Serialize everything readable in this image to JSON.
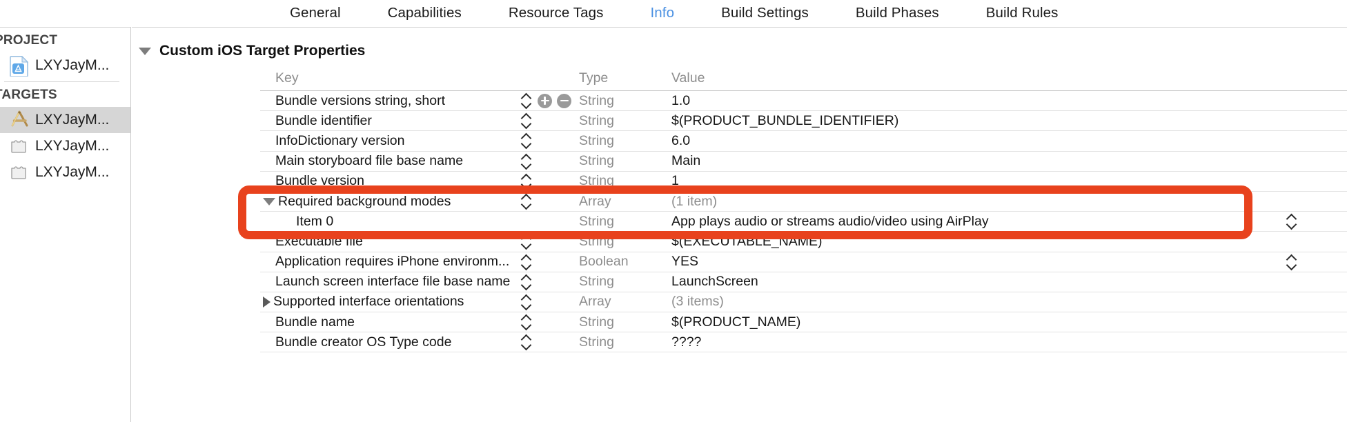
{
  "tabs": [
    {
      "label": "General",
      "active": false
    },
    {
      "label": "Capabilities",
      "active": false
    },
    {
      "label": "Resource Tags",
      "active": false
    },
    {
      "label": "Info",
      "active": true
    },
    {
      "label": "Build Settings",
      "active": false
    },
    {
      "label": "Build Phases",
      "active": false
    },
    {
      "label": "Build Rules",
      "active": false
    }
  ],
  "sidebar": {
    "project_header": "PROJECT",
    "targets_header": "TARGETS",
    "project_items": [
      {
        "label": "LXYJayM...",
        "icon": "project-document-icon"
      }
    ],
    "target_items": [
      {
        "label": "LXYJayM...",
        "icon": "app-target-icon",
        "selected": true
      },
      {
        "label": "LXYJayM...",
        "icon": "bundle-target-icon",
        "selected": false
      },
      {
        "label": "LXYJayM...",
        "icon": "bundle-target-icon",
        "selected": false
      }
    ]
  },
  "main": {
    "section_title": "Custom iOS Target Properties",
    "columns": {
      "key": "Key",
      "type": "Type",
      "value": "Value"
    },
    "rows": [
      {
        "key": "Bundle versions string, short",
        "type": "String",
        "value": "1.0",
        "indent": 0,
        "disclosure": "none",
        "stepper": true,
        "plusminus": true,
        "muted_value": false,
        "right_stepper": false
      },
      {
        "key": "Bundle identifier",
        "type": "String",
        "value": "$(PRODUCT_BUNDLE_IDENTIFIER)",
        "indent": 0,
        "disclosure": "none",
        "stepper": true,
        "plusminus": false,
        "muted_value": false,
        "right_stepper": false
      },
      {
        "key": "InfoDictionary version",
        "type": "String",
        "value": "6.0",
        "indent": 0,
        "disclosure": "none",
        "stepper": true,
        "plusminus": false,
        "muted_value": false,
        "right_stepper": false
      },
      {
        "key": "Main storyboard file base name",
        "type": "String",
        "value": "Main",
        "indent": 0,
        "disclosure": "none",
        "stepper": true,
        "plusminus": false,
        "muted_value": false,
        "right_stepper": false
      },
      {
        "key": "Bundle version",
        "type": "String",
        "value": "1",
        "indent": 0,
        "disclosure": "none",
        "stepper": true,
        "plusminus": false,
        "muted_value": false,
        "right_stepper": false
      },
      {
        "key": "Required background modes",
        "type": "Array",
        "value": "(1 item)",
        "indent": 0,
        "disclosure": "expanded",
        "stepper": true,
        "plusminus": false,
        "muted_value": true,
        "right_stepper": false
      },
      {
        "key": "Item 0",
        "type": "String",
        "value": "App plays audio or streams audio/video using AirPlay",
        "indent": 1,
        "disclosure": "none",
        "stepper": false,
        "plusminus": false,
        "muted_value": false,
        "right_stepper": true
      },
      {
        "key": "Executable file",
        "type": "String",
        "value": "$(EXECUTABLE_NAME)",
        "indent": 0,
        "disclosure": "none",
        "stepper": true,
        "plusminus": false,
        "muted_value": false,
        "right_stepper": false
      },
      {
        "key": "Application requires iPhone environm...",
        "type": "Boolean",
        "value": "YES",
        "indent": 0,
        "disclosure": "none",
        "stepper": true,
        "plusminus": false,
        "muted_value": false,
        "right_stepper": true
      },
      {
        "key": "Launch screen interface file base name",
        "type": "String",
        "value": "LaunchScreen",
        "indent": 0,
        "disclosure": "none",
        "stepper": true,
        "plusminus": false,
        "muted_value": false,
        "right_stepper": false
      },
      {
        "key": "Supported interface orientations",
        "type": "Array",
        "value": "(3 items)",
        "indent": 0,
        "disclosure": "collapsed",
        "stepper": true,
        "plusminus": false,
        "muted_value": true,
        "right_stepper": false
      },
      {
        "key": "Bundle name",
        "type": "String",
        "value": "$(PRODUCT_NAME)",
        "indent": 0,
        "disclosure": "none",
        "stepper": true,
        "plusminus": false,
        "muted_value": false,
        "right_stepper": false
      },
      {
        "key": "Bundle creator OS Type code",
        "type": "String",
        "value": "????",
        "indent": 0,
        "disclosure": "none",
        "stepper": true,
        "plusminus": false,
        "muted_value": false,
        "right_stepper": false
      }
    ]
  },
  "annotation": {
    "color": "#e8421d",
    "highlighted_rows": [
      "Required background modes",
      "Item 0"
    ]
  }
}
